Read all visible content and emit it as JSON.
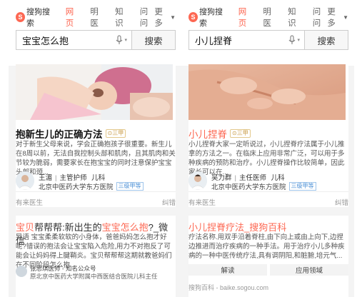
{
  "brand": {
    "name": "搜狗搜索",
    "accent": "#fd6853"
  },
  "nav": {
    "tabs": [
      "网页",
      "明医",
      "知识",
      "问问"
    ],
    "more": "更多"
  },
  "left": {
    "search": {
      "query": "宝宝怎么抱",
      "button": "搜索"
    },
    "result": {
      "title": "抱新生儿的正确方法",
      "badge": "三甲",
      "summary": "对于新生父母来说，学会正确抱孩子很重要。新生儿在8周以前，无法自我控制头部和肌肉，且其肌肉和关节较为脆弱，需要家长在抱宝宝的同时注意保护宝宝头部和颈...",
      "doctor": {
        "name": "王湄",
        "title": "主管护师",
        "dept": "儿科",
        "hospital": "北京中医药大学东方医院",
        "tag": "三级甲等"
      },
      "footer_left": "有来医生",
      "footer_right": "纠错"
    },
    "result2": {
      "title_pre": "宝贝",
      "title_mid": "帮帮帮:新出生的",
      "title_hl": "宝宝怎么抱",
      "title_end": "?_微信",
      "summary": "导语 宝宝柔柔软软的小身体，爸爸妈妈怎么抱才好呢?错误的抱法会让宝宝陷入危险,用力不对抱反了可能会让妈妈得上腱鞘炎。宝贝帮帮帮这期就教爸妈们在不同阶段怎么抱...",
      "doc_name": "张思琪医师 - 知名公众号",
      "doc_hosp": "原北京中医药大学附属中西医结合医院儿科主任"
    }
  },
  "right": {
    "search": {
      "query": "小儿捏脊",
      "button": "搜索"
    },
    "result": {
      "title": "小儿捏脊",
      "badge": "三甲",
      "summary": "小儿捏脊大家一定听说过，小儿捏脊疗法属于小儿推拿的方法之一。在临床上应用非常广泛，可以用于多种疾病的预防和治疗。小儿捏脊操作比较简单，因此家长可以在...",
      "doctor": {
        "name": "吴力群",
        "title": "主任医师",
        "dept": "儿科",
        "hospital": "北京中医药大学东方医院",
        "tag": "三级甲等"
      },
      "footer_left": "有来医生",
      "footer_right": "纠错"
    },
    "result2": {
      "title": "小儿捏脊疗法_搜狗百科",
      "summary": "疗法名称.用双手沿着脊柱,由下向上或由上向下,边捏边推进而治疗疾病的一种手法。用于治疗小儿多种疾病的一种中医传统疗法,具有调阴阳,和脏腑,培元气...",
      "buttons": [
        "解读",
        "应用领域"
      ],
      "source": "搜狗百科 - baike.sogou.com"
    }
  }
}
